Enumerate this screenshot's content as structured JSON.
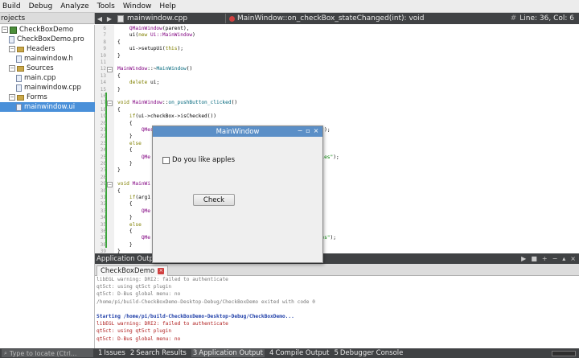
{
  "menu": [
    "Build",
    "Debug",
    "Analyze",
    "Tools",
    "Window",
    "Help"
  ],
  "project_pane": {
    "header": "rojects",
    "tree": [
      {
        "label": "CheckBoxDemo",
        "level": 0,
        "kind": "project",
        "toggle": "−"
      },
      {
        "label": "CheckBoxDemo.pro",
        "level": 1,
        "kind": "file",
        "toggle": ""
      },
      {
        "label": "Headers",
        "level": 1,
        "kind": "folder",
        "toggle": "−"
      },
      {
        "label": "mainwindow.h",
        "level": 2,
        "kind": "file",
        "toggle": ""
      },
      {
        "label": "Sources",
        "level": 1,
        "kind": "folder",
        "toggle": "−"
      },
      {
        "label": "main.cpp",
        "level": 2,
        "kind": "file",
        "toggle": ""
      },
      {
        "label": "mainwindow.cpp",
        "level": 2,
        "kind": "file",
        "toggle": ""
      },
      {
        "label": "Forms",
        "level": 1,
        "kind": "folder",
        "toggle": "−"
      },
      {
        "label": "mainwindow.ui",
        "level": 2,
        "kind": "file",
        "toggle": "",
        "selected": true
      }
    ]
  },
  "editor_tabs": {
    "file": "mainwindow.cpp",
    "function": "MainWindow::on_checkBox_stateChanged(int): void",
    "line_col": "Line: 36, Col: 6"
  },
  "editor": {
    "lines": [
      {
        "n": "6",
        "html": "    <span class=\"ty\">QMainWindow</span>(parent),",
        "fold": ""
      },
      {
        "n": "7",
        "html": "    ui(<span class=\"kw\">new</span> <span class=\"ty\">Ui::MainWindow</span>)",
        "fold": ""
      },
      {
        "n": "8",
        "html": "{",
        "fold": ""
      },
      {
        "n": "9",
        "html": "    ui-&gt;setupUi(<span class=\"kw\">this</span>);",
        "fold": ""
      },
      {
        "n": "10",
        "html": "}",
        "fold": ""
      },
      {
        "n": "11",
        "html": "",
        "fold": ""
      },
      {
        "n": "12",
        "html": "<span class=\"ty\">MainWindow</span>::~<span class=\"fn\">MainWindow</span>()",
        "fold": "−"
      },
      {
        "n": "13",
        "html": "{",
        "fold": ""
      },
      {
        "n": "14",
        "html": "    <span class=\"kw\">delete</span> ui;",
        "fold": ""
      },
      {
        "n": "15",
        "html": "}",
        "fold": ""
      },
      {
        "n": "16",
        "html": "",
        "fold": ""
      },
      {
        "n": "17",
        "html": "<span class=\"kw\">void</span> <span class=\"ty\">MainWindow</span>::<span class=\"fn\">on_pushButton_clicked</span>()",
        "fold": "−"
      },
      {
        "n": "18",
        "html": "{",
        "fold": ""
      },
      {
        "n": "19",
        "html": "    <span class=\"kw\">if</span>(ui-&gt;checkBox-&gt;isChecked())",
        "fold": ""
      },
      {
        "n": "20",
        "html": "    {",
        "fold": ""
      },
      {
        "n": "21",
        "html": "        <span class=\"ty\">QMessageBox</span>::information(<span class=\"kw\">this</span>,<span class=\"st\">\"title\"</span>,<span class=\"st\">\"Yes user likes apples\"</span>);",
        "fold": ""
      },
      {
        "n": "22",
        "html": "    }",
        "fold": ""
      },
      {
        "n": "23",
        "html": "    <span class=\"kw\">else</span>",
        "fold": ""
      },
      {
        "n": "24",
        "html": "    {",
        "fold": ""
      },
      {
        "n": "25",
        "html": "        <span class=\"ty\">QMe</span>                                                       <span class=\"st\">pples\"</span>);",
        "fold": ""
      },
      {
        "n": "26",
        "html": "    }",
        "fold": ""
      },
      {
        "n": "27",
        "html": "}",
        "fold": ""
      },
      {
        "n": "28",
        "html": "",
        "fold": ""
      },
      {
        "n": "29",
        "html": "<span class=\"kw\">void</span> <span class=\"ty\">MainWi</span>",
        "fold": "−"
      },
      {
        "n": "30",
        "html": "{",
        "fold": ""
      },
      {
        "n": "31",
        "html": "    <span class=\"kw\">if</span>(arg1",
        "fold": ""
      },
      {
        "n": "32",
        "html": "    {",
        "fold": ""
      },
      {
        "n": "33",
        "html": "        <span class=\"ty\">QMe</span>                                                      );",
        "fold": ""
      },
      {
        "n": "34",
        "html": "    }",
        "fold": ""
      },
      {
        "n": "35",
        "html": "    <span class=\"kw\">else</span>",
        "fold": ""
      },
      {
        "n": "36",
        "html": "    {",
        "fold": ""
      },
      {
        "n": "37",
        "html": "        <span class=\"ty\">QMe</span>                                                      <span class=\"st\">pples\"</span>);",
        "fold": ""
      },
      {
        "n": "38",
        "html": "    }",
        "fold": ""
      },
      {
        "n": "39",
        "html": "}",
        "fold": ""
      }
    ],
    "visible_line_number": "36"
  },
  "dialog": {
    "title": "MainWindow",
    "checkbox_label": "Do you like apples",
    "button_label": "Check",
    "title_buttons": [
      "−",
      "▫",
      "×"
    ]
  },
  "output": {
    "header": "Application Output",
    "run_tab": "CheckBoxDemo",
    "lines": [
      {
        "text": "libEGL warning: DRI2: failed to authenticate",
        "style": "gray"
      },
      {
        "text": "qt5ct: using qt5ct plugin",
        "style": "gray"
      },
      {
        "text": "qt5ct: D-Bus global menu: no",
        "style": "gray"
      },
      {
        "text": "/home/pi/build-CheckBoxDemo-Desktop-Debug/CheckBoxDemo exited with code 0",
        "style": "gray"
      },
      {
        "text": "",
        "style": "gray"
      },
      {
        "text": "Starting /home/pi/build-CheckBoxDemo-Desktop-Debug/CheckBoxDemo...",
        "style": "blue"
      },
      {
        "text": "libEGL warning: DRI2: failed to authenticate",
        "style": "red"
      },
      {
        "text": "qt5ct: using qt5ct plugin",
        "style": "red"
      },
      {
        "text": "qt5ct: D-Bus global menu: no",
        "style": "red"
      }
    ]
  },
  "statusbar": {
    "locate_placeholder": "Type to locate (Ctrl...",
    "tabs": [
      {
        "n": "1",
        "label": "Issues"
      },
      {
        "n": "2",
        "label": "Search Results"
      },
      {
        "n": "3",
        "label": "Application Output",
        "active": true
      },
      {
        "n": "4",
        "label": "Compile Output"
      },
      {
        "n": "5",
        "label": "Debugger Console"
      }
    ]
  }
}
